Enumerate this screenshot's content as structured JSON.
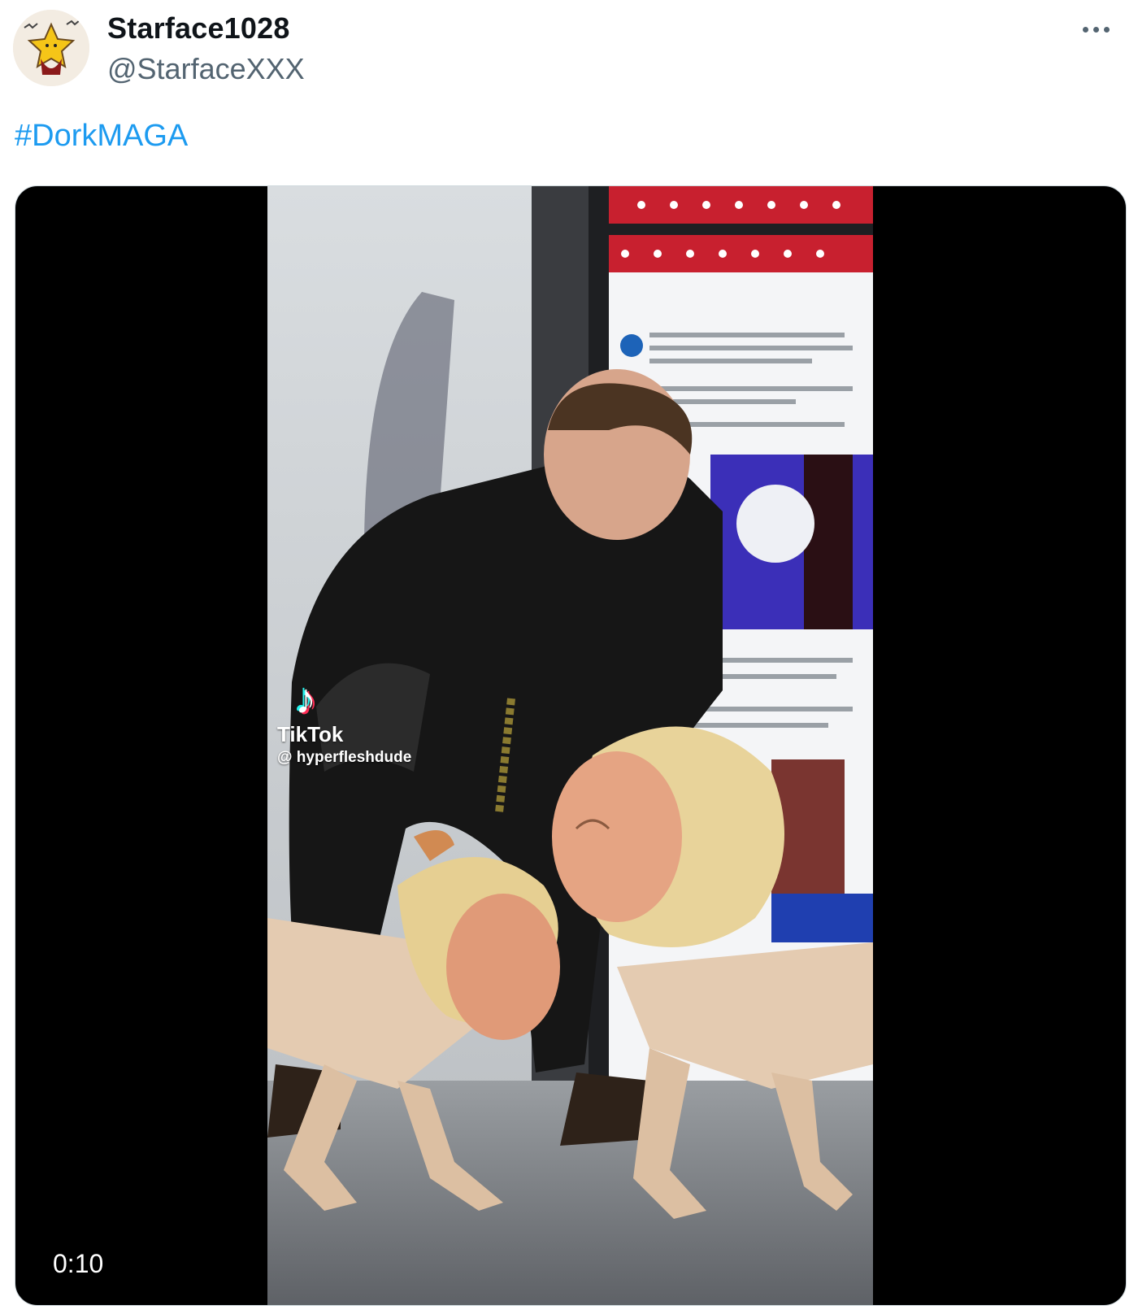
{
  "tweet": {
    "display_name": "Starface1028",
    "handle": "@StarfaceXXX",
    "text": "#DorkMAGA",
    "more_icon": "more-horizontal-icon"
  },
  "media": {
    "type": "video",
    "duration": "0:10",
    "watermark": {
      "icon": "tiktok-logo-icon",
      "brand": "TikTok",
      "user": "@ hyperfleshdude"
    }
  },
  "colors": {
    "link": "#1d9bf0",
    "primary_text": "#0f1419",
    "secondary_text": "#536471",
    "media_bg": "#000000"
  }
}
